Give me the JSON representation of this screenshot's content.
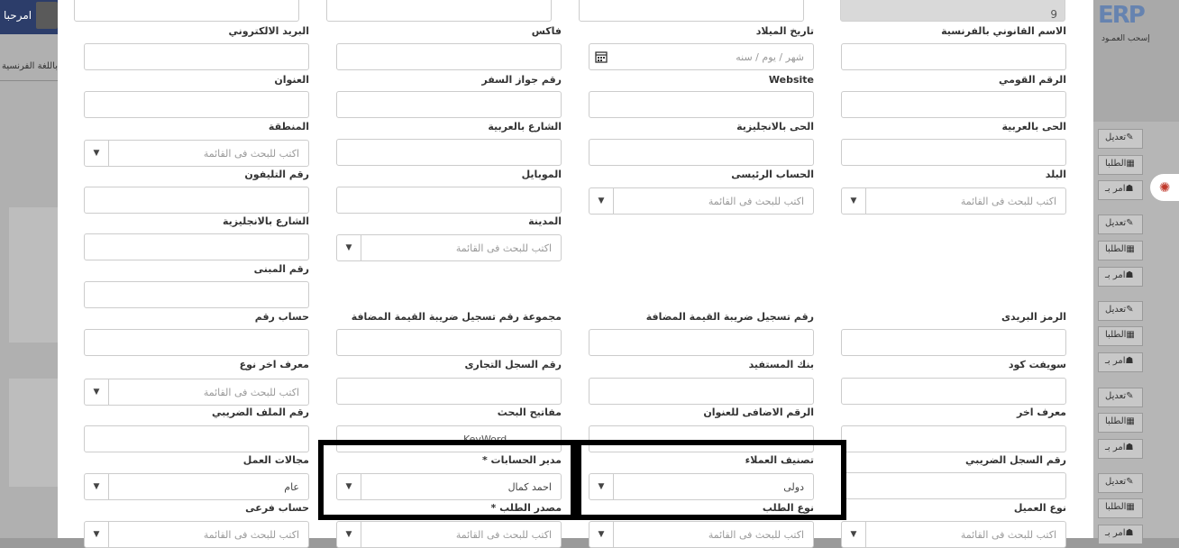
{
  "background": {
    "user_name": "امرحبا",
    "left_tab": "باللغة الفرنسية",
    "logo_text": "ERP",
    "logo_sub": "إسحب العمـود",
    "actions": [
      {
        "label": "تعديل",
        "icon": "pencil-icon"
      },
      {
        "label": "الطلبا",
        "icon": "chart-icon"
      },
      {
        "label": "امر بـ",
        "icon": "users-icon"
      },
      {
        "label": "تعديل",
        "icon": "pencil-icon"
      },
      {
        "label": "الطلبا",
        "icon": "chart-icon"
      },
      {
        "label": "امر بـ",
        "icon": "users-icon"
      },
      {
        "label": "تعديل",
        "icon": "pencil-icon"
      },
      {
        "label": "الطلبا",
        "icon": "chart-icon"
      },
      {
        "label": "امر بـ",
        "icon": "users-icon"
      },
      {
        "label": "تعديل",
        "icon": "pencil-icon"
      },
      {
        "label": "الطلبا",
        "icon": "chart-icon"
      },
      {
        "label": "امر بـ",
        "icon": "users-icon"
      },
      {
        "label": "تعديل",
        "icon": "pencil-icon"
      },
      {
        "label": "الطلبا",
        "icon": "chart-icon"
      },
      {
        "label": "امر بـ",
        "icon": "users-icon"
      }
    ],
    "ai_icon": "brain-icon"
  },
  "form": {
    "top_row": {
      "value_readonly": "9"
    },
    "labels": {
      "legal_name_fr": "الاسم القانوني بالفرنسية",
      "birth_date": "تاريخ الميلاد",
      "fax": "فاكس",
      "email": "البريد الالكتروني",
      "national_id": "الرقم القومي",
      "website": "Website",
      "passport": "رقم جواز السفر",
      "address": "العنوان",
      "district_ar": "الحى بالعربية",
      "district_en": "الحى بالانجليزية",
      "street_ar": "الشارع بالعربية",
      "region": "المنطقة",
      "country": "البلد",
      "main_account": "الحساب الرئيسى",
      "mobile": "الموبايل",
      "phone": "رقم التليفون",
      "city": "المدينة",
      "street_en": "الشارع بالانجليزية",
      "building_no": "رقم المبنى",
      "postal_code": "الرمز البريدى",
      "vat_no": "رقم تسجيل ضريبة القيمة المضافة",
      "vat_group": "مجموعة رقم تسجيل ضريبة القيمة المضافة",
      "account_no": "حساب رقم",
      "swift": "سويفت كود",
      "beneficiary_bank": "بنك المستفيد",
      "commercial_reg": "رقم السجل التجارى",
      "other_id_type": "معرف اخر نوع",
      "other_id": "معرف اخر",
      "additional_address_no": "الرقم الاضافى للعنوان",
      "search_keys": "مفاتيح البحث",
      "tax_file_no": "رقم الملف الضريبي",
      "tax_reg_no": "رقم السجل الضريبي",
      "customer_class": "تصنيف العملاء",
      "account_manager": "مدير الحسابات *",
      "work_fields": "مجالات العمل",
      "customer_type": "نوع العميل",
      "request_type": "نوع الطلب",
      "request_source": "مصدر الطلب *",
      "sub_account": "حساب فرعى"
    },
    "date_placeholder": "شهر / يوم / سنه",
    "search_placeholder": "اكتب للبحث فى القائمة",
    "keyword_overflow": "KeyWord",
    "values": {
      "customer_class": "دولى",
      "account_manager": "احمد كمال",
      "work_fields": "عام"
    }
  }
}
